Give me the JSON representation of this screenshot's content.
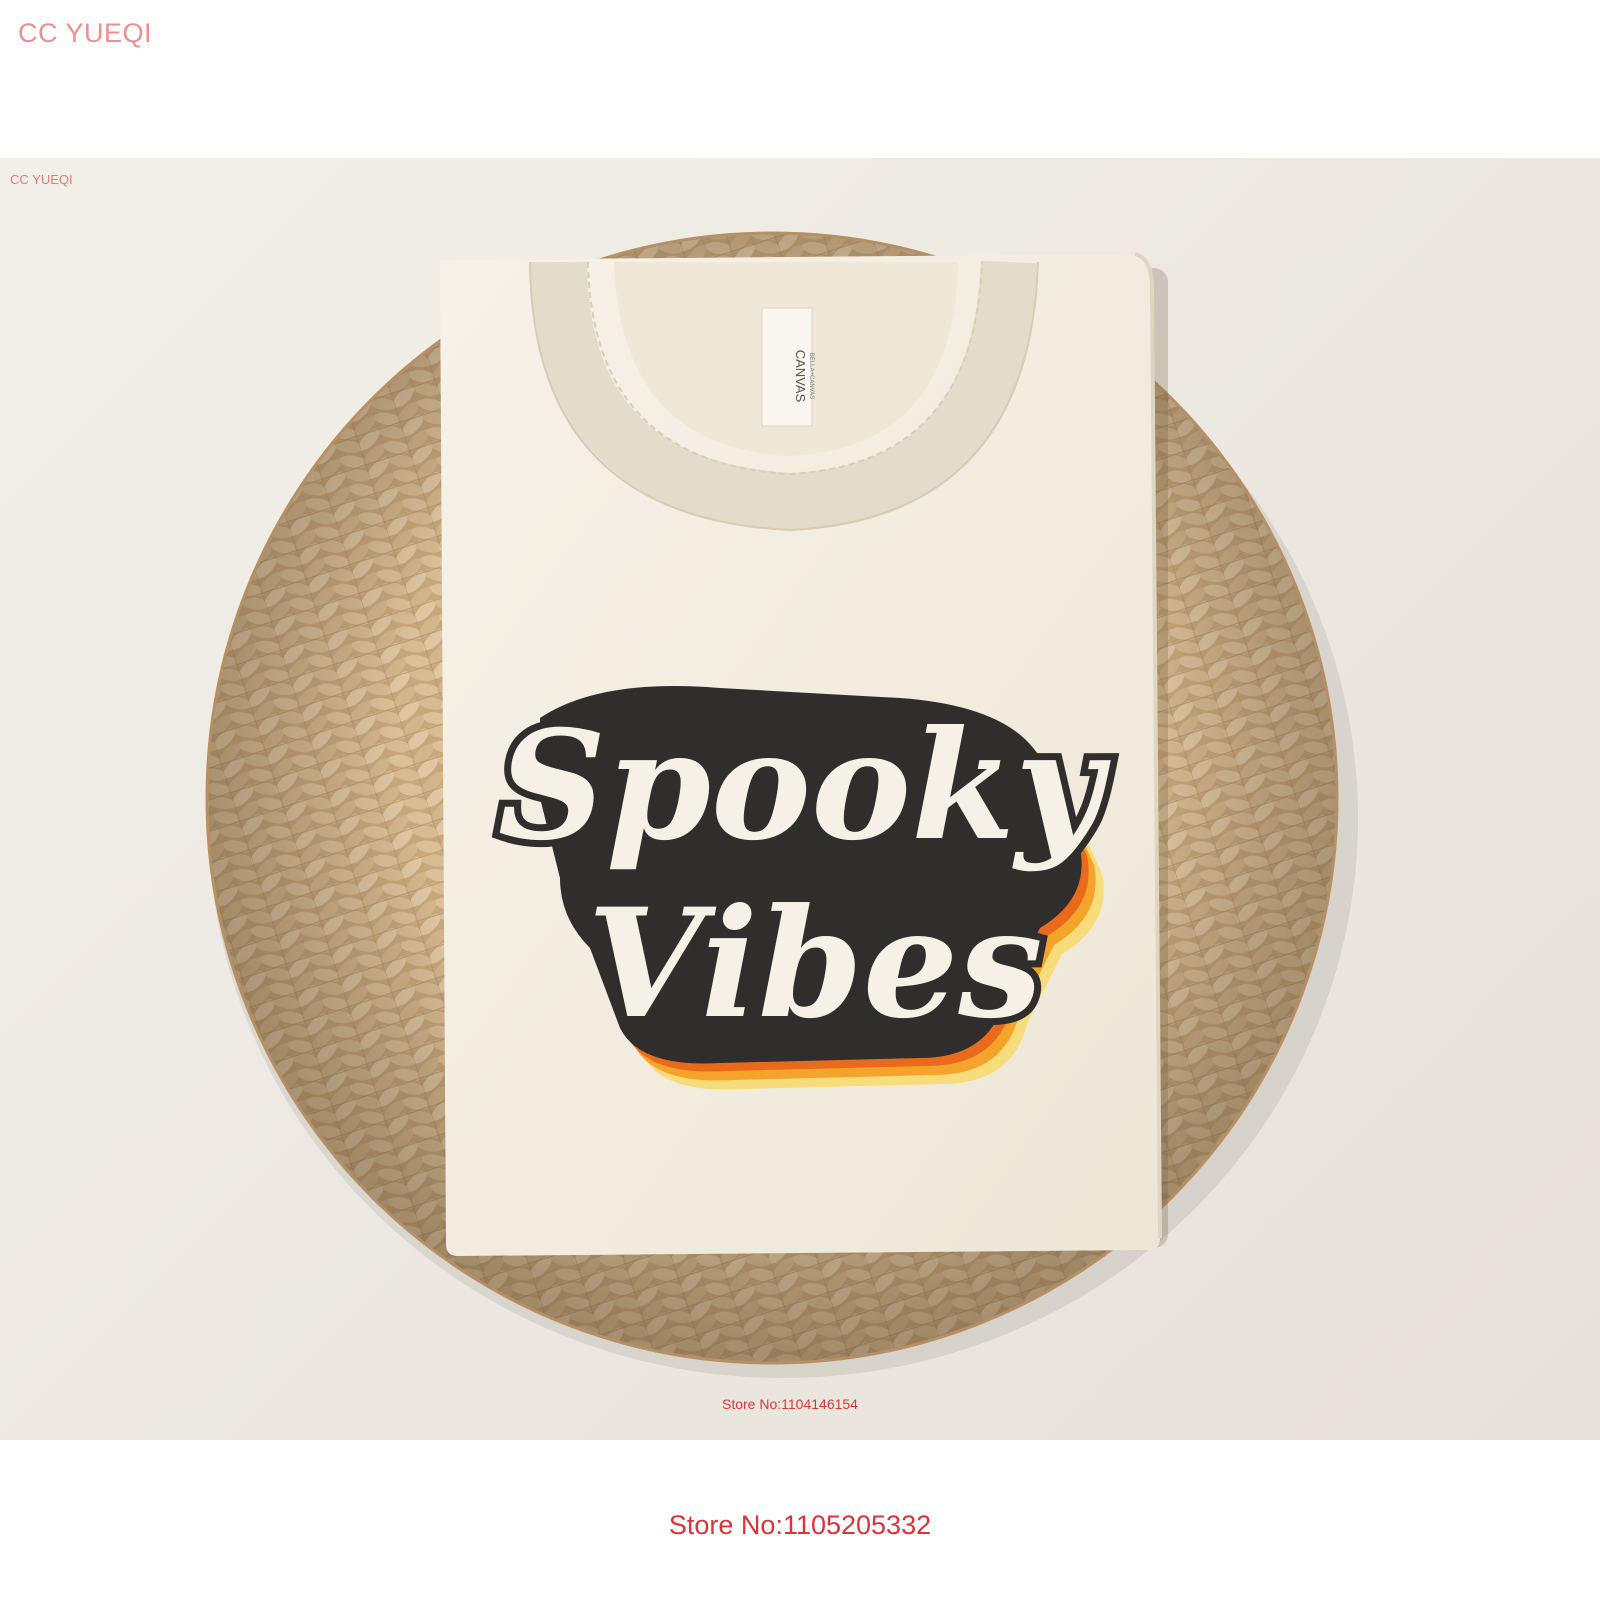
{
  "watermark": {
    "top_left": "CC YUEQI",
    "photo_corner": "CC YUEQI"
  },
  "store": {
    "inner_label": "Store No:1104146154",
    "bottom_label": "Store No:1105205332"
  },
  "shirt": {
    "tag_brand": "CANVAS",
    "tag_sub": "BELLA+CANVAS",
    "print_line1": "Spooky",
    "print_line2": "Vibes"
  },
  "colors": {
    "background": "#ece8e1",
    "basket": "#c6a478",
    "shirt": "#f3eee2",
    "print_outline": "#2f2e2c",
    "print_fill": "#f6f1e6",
    "shadow_orange": "#ea6a1c",
    "shadow_amber": "#f4a42a",
    "shadow_yellow": "#f6dc7a",
    "watermark": "#f08d8d",
    "store_label": "#e0313b"
  }
}
